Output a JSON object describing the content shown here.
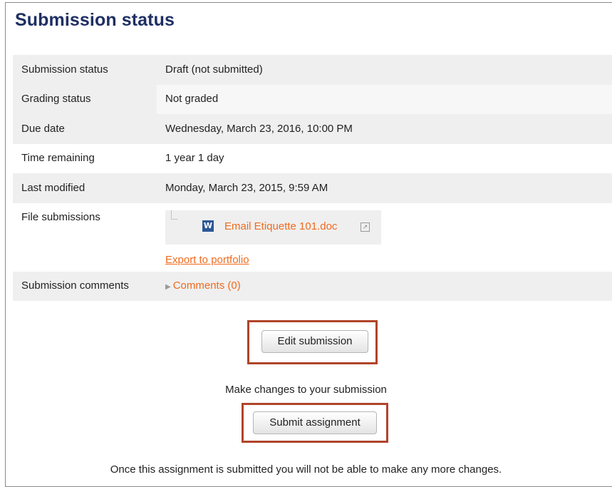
{
  "page": {
    "title": "Submission status"
  },
  "table": {
    "rows": [
      {
        "label": "Submission status",
        "value": "Draft (not submitted)"
      },
      {
        "label": "Grading status",
        "value": "Not graded"
      },
      {
        "label": "Due date",
        "value": "Wednesday, March 23, 2016, 10:00 PM"
      },
      {
        "label": "Time remaining",
        "value": "1 year 1 day"
      },
      {
        "label": "Last modified",
        "value": "Monday, March 23, 2015, 9:59 AM"
      },
      {
        "label": "File submissions"
      },
      {
        "label": "Submission comments"
      }
    ],
    "file": {
      "name": "Email Etiquette 101.doc",
      "icon_glyph": "W",
      "icon": "word-document-icon"
    },
    "export_link": "Export to portfolio",
    "comments_link": "Comments (0)"
  },
  "actions": {
    "edit_button": "Edit submission",
    "edit_help": "Make changes to your submission",
    "submit_button": "Submit assignment",
    "submit_help": "Once this assignment is submitted you will not be able to make any more changes."
  },
  "colors": {
    "link": "#f06b1d",
    "title": "#1e2f63",
    "highlight_box": "#b0442a",
    "row_shade": "#efefef"
  }
}
